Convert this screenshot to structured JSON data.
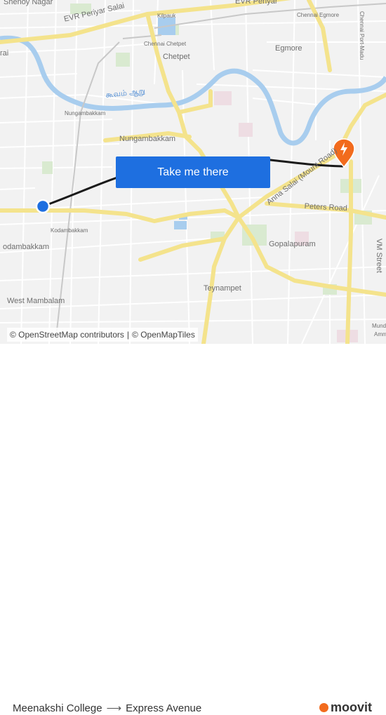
{
  "map": {
    "labels": {
      "shenoy_nagar": "Shenoy Nagar",
      "evr_periyar_salai_1": "EVR Periyar Salai",
      "evr_periyar_salai_2": "EVR Periyar",
      "kilpauk": "Kilpauk",
      "chennai_egmore": "Chennai Egmore",
      "chennai_port_madu": "Chennai Port-Madu",
      "chennai_chetpet": "Chennai Chetpet",
      "chetpet": "Chetpet",
      "egmore": "Egmore",
      "rai": "rai",
      "cooum_tamil": "கூவம் ஆறு",
      "nungambakkam_station": "Nungambakkam",
      "nungambakkam": "Nungambakkam",
      "anna_salai": "Anna Salai (Mount Road)",
      "peters_road": "Peters Road",
      "kodambakkam_station": "Kodambakkam",
      "kodambakkam": "odambakkam",
      "gopalapuram": "Gopalapuram",
      "vm_street": "VM Street",
      "teynampet": "Teynampet",
      "west_mambalam": "West Mambalam",
      "mundi": "Mundi",
      "amm": "Amm"
    },
    "origin_color": "#1e6fe0",
    "destination_color": "#f26b1d",
    "route_color": "#1a1a1a"
  },
  "cta": {
    "label": "Take me there"
  },
  "attribution": {
    "osm": "© OpenStreetMap contributors",
    "separator": "|",
    "tiles": "© OpenMapTiles"
  },
  "footer": {
    "origin": "Meenakshi College",
    "arrow": "⟶",
    "destination": "Express Avenue",
    "brand": "moovit"
  }
}
